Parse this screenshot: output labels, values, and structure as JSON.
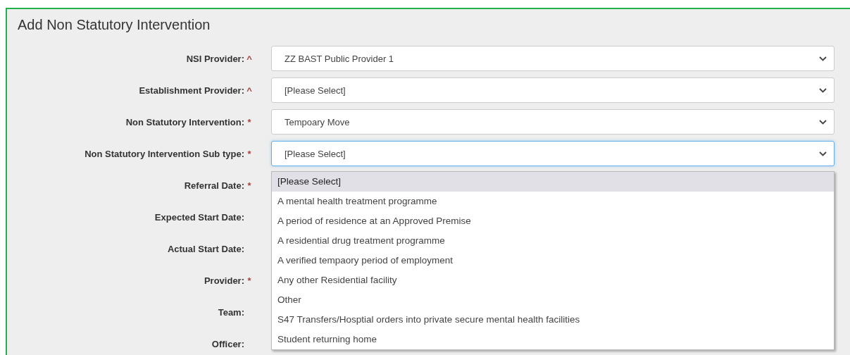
{
  "title": "Add Non Statutory Intervention",
  "fields": [
    {
      "label": "NSI Provider:",
      "required_mark": "^",
      "kind": "select",
      "value": "ZZ BAST Public Provider 1",
      "focused": false
    },
    {
      "label": "Establishment Provider:",
      "required_mark": "^",
      "kind": "select",
      "value": "[Please Select]",
      "focused": false
    },
    {
      "label": "Non Statutory Intervention:",
      "required_mark": "*",
      "kind": "select",
      "value": "Tempoary Move",
      "focused": false
    },
    {
      "label": "Non Statutory Intervention Sub type:",
      "required_mark": "*",
      "kind": "select",
      "value": "[Please Select]",
      "focused": true
    },
    {
      "label": "Referral Date:",
      "required_mark": "*",
      "kind": "hidden"
    },
    {
      "label": "Expected Start Date:",
      "kind": "hidden"
    },
    {
      "label": "Actual Start Date:",
      "kind": "hidden"
    },
    {
      "label": "Provider:",
      "required_mark": "*",
      "kind": "hidden"
    },
    {
      "label": "Team:",
      "kind": "hidden"
    },
    {
      "label": "Officer:",
      "kind": "hidden"
    }
  ],
  "dropdown": {
    "options": [
      {
        "label": "[Please Select]",
        "selected": true
      },
      {
        "label": "A mental health treatment programme",
        "selected": false
      },
      {
        "label": "A period of residence at an Approved Premise",
        "selected": false
      },
      {
        "label": "A residential drug treatment programme",
        "selected": false
      },
      {
        "label": "A verified tempaory period of employment",
        "selected": false
      },
      {
        "label": "Any other Residential facility",
        "selected": false
      },
      {
        "label": "Other",
        "selected": false
      },
      {
        "label": "S47 Transfers/Hosptial orders into private secure mental health facilities",
        "selected": false
      },
      {
        "label": "Student returning home",
        "selected": false
      }
    ]
  }
}
